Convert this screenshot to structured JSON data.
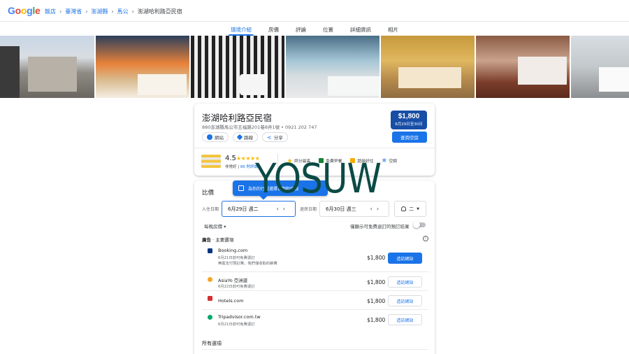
{
  "header": {
    "logo": "Google",
    "breadcrumbs": [
      "飯店",
      "臺灣省",
      "澎湖縣",
      "馬公"
    ],
    "current": "澎湖哈利路亞民宿"
  },
  "tabs": [
    {
      "label": "環境介紹",
      "active": true
    },
    {
      "label": "房價",
      "active": false
    },
    {
      "label": "評論",
      "active": false
    },
    {
      "label": "位置",
      "active": false
    },
    {
      "label": "詳細資訊",
      "active": false
    },
    {
      "label": "相片",
      "active": false
    }
  ],
  "hotel": {
    "name": "澎湖哈利路亞民宿",
    "address": "880澎湖縣馬公市五福路201巷8弄1號 • 0921 202 747",
    "chips": {
      "website": "網站",
      "directions": "路線",
      "share": "分享"
    },
    "price": "$1,800",
    "price_dates": "6月29日至30日",
    "check_availability": "查詢空房",
    "rating": "4.5",
    "stars": "★★★★★",
    "rating_word": "非常好",
    "reviews": "86 則評論",
    "amenities": [
      "評分最高",
      "免費早餐",
      "超級好住",
      "空調"
    ]
  },
  "compare": {
    "title": "比價",
    "tooltip": "為你的行程選擇日期和房價",
    "checkin_label": "入住日期",
    "checkin": "6月29日 週二",
    "checkout_label": "退房日期",
    "checkout": "6月30日 週三",
    "guests": "二",
    "nightly": "每晚房價 ▾",
    "free_cancel": "僅顯示可免費退訂的預訂結果",
    "ads_prefix": "廣告",
    "ads_title": "· 主要選項",
    "offers": [
      {
        "name": "Booking.com",
        "sub": "6月21日前可免費退訂",
        "sub2": "無需支付預訂費，我們僅收取的薪費",
        "price": "$1,800",
        "visit": "造訪網站",
        "primary": true,
        "color": "#003580"
      },
      {
        "name": "AsiaYo 亞洲遊",
        "sub": "6月22日前可免費退訂",
        "sub2": "",
        "price": "$1,800",
        "visit": "造訪網站",
        "primary": false,
        "color": "#f5a623"
      },
      {
        "name": "Hotels.com",
        "sub": "",
        "sub2": "",
        "price": "$1,800",
        "visit": "造訪網站",
        "primary": false,
        "color": "#d32f2f"
      },
      {
        "name": "Tripadvisor.com.tw",
        "sub": "6月21日前可免費退訂",
        "sub2": "",
        "price": "$1,800",
        "visit": "造訪網站",
        "primary": false,
        "color": "#00aa6c"
      }
    ],
    "all_options": "所有選項"
  },
  "watermark": "YOSUW",
  "colors": {
    "accent": "#1a73e8",
    "price_badge": "#174ea6"
  }
}
